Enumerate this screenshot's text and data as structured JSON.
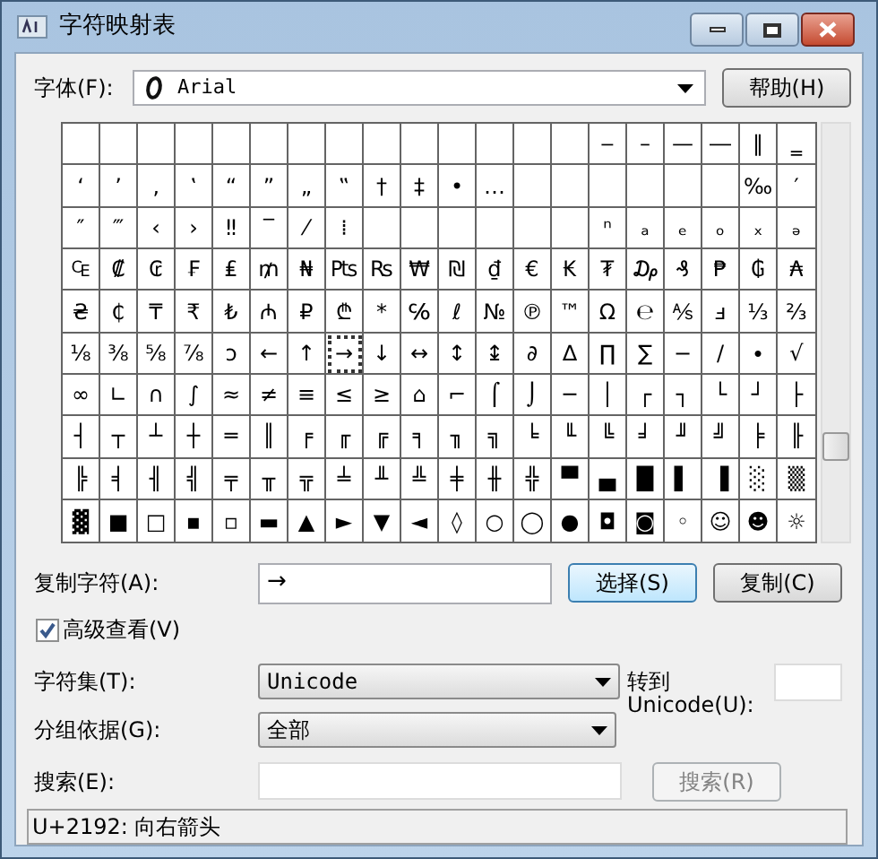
{
  "window": {
    "title": "字符映射表"
  },
  "font": {
    "label": "字体(F):",
    "value": "Arial"
  },
  "help_button": "帮助(H)",
  "grid": {
    "rows": [
      {
        "cells": [
          {
            "kind": "blank",
            "selected": false
          },
          {
            "kind": "blank",
            "selected": false
          },
          {
            "kind": "blank",
            "selected": false
          },
          {
            "kind": "blank",
            "selected": false
          },
          {
            "kind": "blank",
            "selected": false
          },
          {
            "kind": "blank",
            "selected": false
          },
          {
            "kind": "blank",
            "selected": false
          },
          {
            "kind": "blank",
            "selected": false
          },
          {
            "kind": "blank",
            "selected": false
          },
          {
            "kind": "blank",
            "selected": false
          },
          {
            "kind": "blank",
            "selected": false
          },
          {
            "kind": "blank",
            "selected": false
          },
          {
            "kind": "blank",
            "selected": false
          },
          {
            "kind": "blank",
            "selected": false
          },
          {
            "kind": "glyph",
            "char": "‒",
            "selected": false
          },
          {
            "kind": "glyph",
            "char": "–",
            "selected": false
          },
          {
            "kind": "glyph",
            "char": "—",
            "selected": false
          },
          {
            "kind": "glyph",
            "char": "―",
            "selected": false
          },
          {
            "kind": "glyph",
            "char": "‖",
            "selected": false
          },
          {
            "kind": "glyph",
            "char": "‗",
            "selected": false
          }
        ]
      },
      {
        "cells": [
          {
            "kind": "glyph",
            "char": "‘",
            "selected": false
          },
          {
            "kind": "glyph",
            "char": "’",
            "selected": false
          },
          {
            "kind": "glyph",
            "char": "‚",
            "selected": false
          },
          {
            "kind": "glyph",
            "char": "‛",
            "selected": false
          },
          {
            "kind": "glyph",
            "char": "“",
            "selected": false
          },
          {
            "kind": "glyph",
            "char": "”",
            "selected": false
          },
          {
            "kind": "glyph",
            "char": "„",
            "selected": false
          },
          {
            "kind": "glyph",
            "char": "‟",
            "selected": false
          },
          {
            "kind": "glyph",
            "char": "†",
            "selected": false
          },
          {
            "kind": "glyph",
            "char": "‡",
            "selected": false
          },
          {
            "kind": "glyph",
            "char": "•",
            "selected": false
          },
          {
            "kind": "glyph",
            "char": "…",
            "selected": false
          },
          {
            "kind": "blank",
            "selected": false
          },
          {
            "kind": "blank",
            "selected": false
          },
          {
            "kind": "blank",
            "selected": false
          },
          {
            "kind": "blank",
            "selected": false
          },
          {
            "kind": "blank",
            "selected": false
          },
          {
            "kind": "blank",
            "selected": false
          },
          {
            "kind": "glyph",
            "char": "‰",
            "selected": false
          },
          {
            "kind": "glyph",
            "char": "′",
            "selected": false
          }
        ]
      },
      {
        "cells": [
          {
            "kind": "glyph",
            "char": "″",
            "selected": false
          },
          {
            "kind": "glyph",
            "char": "‴",
            "selected": false
          },
          {
            "kind": "glyph",
            "char": "‹",
            "selected": false
          },
          {
            "kind": "glyph",
            "char": "›",
            "selected": false
          },
          {
            "kind": "glyph",
            "char": "‼",
            "selected": false
          },
          {
            "kind": "glyph",
            "char": "‾",
            "selected": false
          },
          {
            "kind": "glyph",
            "char": "⁄",
            "selected": false
          },
          {
            "kind": "glyph",
            "char": "⁞",
            "selected": false
          },
          {
            "kind": "blank",
            "selected": false
          },
          {
            "kind": "blank",
            "selected": false
          },
          {
            "kind": "blank",
            "selected": false
          },
          {
            "kind": "blank",
            "selected": false
          },
          {
            "kind": "blank",
            "selected": false
          },
          {
            "kind": "blank",
            "selected": false
          },
          {
            "kind": "glyph",
            "char": "ⁿ",
            "selected": false
          },
          {
            "kind": "glyph",
            "char": "ₐ",
            "selected": false
          },
          {
            "kind": "glyph",
            "char": "ₑ",
            "selected": false
          },
          {
            "kind": "glyph",
            "char": "ₒ",
            "selected": false
          },
          {
            "kind": "glyph",
            "char": "ₓ",
            "selected": false
          },
          {
            "kind": "glyph",
            "char": "ₔ",
            "selected": false
          }
        ]
      },
      {
        "cells": [
          {
            "kind": "glyph",
            "char": "₠",
            "selected": false
          },
          {
            "kind": "glyph",
            "char": "₡",
            "selected": false
          },
          {
            "kind": "glyph",
            "char": "₢",
            "selected": false
          },
          {
            "kind": "glyph",
            "char": "₣",
            "selected": false
          },
          {
            "kind": "glyph",
            "char": "₤",
            "selected": false
          },
          {
            "kind": "glyph",
            "char": "₥",
            "selected": false
          },
          {
            "kind": "glyph",
            "char": "₦",
            "selected": false
          },
          {
            "kind": "glyph",
            "char": "₧",
            "selected": false
          },
          {
            "kind": "glyph",
            "char": "₨",
            "selected": false
          },
          {
            "kind": "glyph",
            "char": "₩",
            "selected": false
          },
          {
            "kind": "glyph",
            "char": "₪",
            "selected": false
          },
          {
            "kind": "glyph",
            "char": "₫",
            "selected": false
          },
          {
            "kind": "glyph",
            "char": "€",
            "selected": false
          },
          {
            "kind": "glyph",
            "char": "₭",
            "selected": false
          },
          {
            "kind": "glyph",
            "char": "₮",
            "selected": false
          },
          {
            "kind": "glyph",
            "char": "₯",
            "selected": false
          },
          {
            "kind": "glyph",
            "char": "₰",
            "selected": false
          },
          {
            "kind": "glyph",
            "char": "₱",
            "selected": false
          },
          {
            "kind": "glyph",
            "char": "₲",
            "selected": false
          },
          {
            "kind": "glyph",
            "char": "₳",
            "selected": false
          }
        ]
      },
      {
        "cells": [
          {
            "kind": "glyph",
            "char": "₴",
            "selected": false
          },
          {
            "kind": "glyph",
            "char": "₵",
            "selected": false
          },
          {
            "kind": "glyph",
            "char": "₸",
            "selected": false
          },
          {
            "kind": "glyph",
            "char": "₹",
            "selected": false
          },
          {
            "kind": "glyph",
            "char": "₺",
            "selected": false
          },
          {
            "kind": "glyph",
            "char": "₼",
            "selected": false
          },
          {
            "kind": "glyph",
            "char": "₽",
            "selected": false
          },
          {
            "kind": "glyph",
            "char": "₾",
            "selected": false
          },
          {
            "kind": "glyph",
            "char": "*",
            "selected": false
          },
          {
            "kind": "glyph",
            "char": "℅",
            "selected": false
          },
          {
            "kind": "glyph",
            "char": "ℓ",
            "selected": false
          },
          {
            "kind": "glyph",
            "char": "№",
            "selected": false
          },
          {
            "kind": "glyph",
            "char": "℗",
            "selected": false
          },
          {
            "kind": "glyph",
            "char": "™",
            "selected": false
          },
          {
            "kind": "glyph",
            "char": "Ω",
            "selected": false
          },
          {
            "kind": "glyph",
            "char": "℮",
            "selected": false
          },
          {
            "kind": "glyph",
            "char": "⅍",
            "selected": false
          },
          {
            "kind": "glyph",
            "char": "ⅎ",
            "selected": false
          },
          {
            "kind": "glyph",
            "char": "⅓",
            "selected": false
          },
          {
            "kind": "glyph",
            "char": "⅔",
            "selected": false
          }
        ]
      },
      {
        "cells": [
          {
            "kind": "glyph",
            "char": "⅛",
            "selected": false
          },
          {
            "kind": "glyph",
            "char": "⅜",
            "selected": false
          },
          {
            "kind": "glyph",
            "char": "⅝",
            "selected": false
          },
          {
            "kind": "glyph",
            "char": "⅞",
            "selected": false
          },
          {
            "kind": "glyph",
            "char": "ↄ",
            "selected": false
          },
          {
            "kind": "glyph",
            "char": "←",
            "selected": false
          },
          {
            "kind": "glyph",
            "char": "↑",
            "selected": false
          },
          {
            "kind": "glyph",
            "char": "→",
            "selected": true
          },
          {
            "kind": "glyph",
            "char": "↓",
            "selected": false
          },
          {
            "kind": "glyph",
            "char": "↔",
            "selected": false
          },
          {
            "kind": "glyph",
            "char": "↕",
            "selected": false
          },
          {
            "kind": "glyph",
            "char": "↨",
            "selected": false
          },
          {
            "kind": "glyph",
            "char": "∂",
            "selected": false
          },
          {
            "kind": "glyph",
            "char": "∆",
            "selected": false
          },
          {
            "kind": "glyph",
            "char": "∏",
            "selected": false
          },
          {
            "kind": "glyph",
            "char": "∑",
            "selected": false
          },
          {
            "kind": "glyph",
            "char": "−",
            "selected": false
          },
          {
            "kind": "glyph",
            "char": "∕",
            "selected": false
          },
          {
            "kind": "glyph",
            "char": "∙",
            "selected": false
          },
          {
            "kind": "glyph",
            "char": "√",
            "selected": false
          }
        ]
      },
      {
        "cells": [
          {
            "kind": "glyph",
            "char": "∞",
            "selected": false
          },
          {
            "kind": "glyph",
            "char": "∟",
            "selected": false
          },
          {
            "kind": "glyph",
            "char": "∩",
            "selected": false
          },
          {
            "kind": "glyph",
            "char": "∫",
            "selected": false
          },
          {
            "kind": "glyph",
            "char": "≈",
            "selected": false
          },
          {
            "kind": "glyph",
            "char": "≠",
            "selected": false
          },
          {
            "kind": "glyph",
            "char": "≡",
            "selected": false
          },
          {
            "kind": "glyph",
            "char": "≤",
            "selected": false
          },
          {
            "kind": "glyph",
            "char": "≥",
            "selected": false
          },
          {
            "kind": "glyph",
            "char": "⌂",
            "selected": false
          },
          {
            "kind": "glyph",
            "char": "⌐",
            "selected": false
          },
          {
            "kind": "glyph",
            "char": "⌠",
            "selected": false
          },
          {
            "kind": "glyph",
            "char": "⌡",
            "selected": false
          },
          {
            "kind": "glyph",
            "char": "─",
            "selected": false
          },
          {
            "kind": "glyph",
            "char": "│",
            "selected": false
          },
          {
            "kind": "glyph",
            "char": "┌",
            "selected": false
          },
          {
            "kind": "glyph",
            "char": "┐",
            "selected": false
          },
          {
            "kind": "glyph",
            "char": "└",
            "selected": false
          },
          {
            "kind": "glyph",
            "char": "┘",
            "selected": false
          },
          {
            "kind": "glyph",
            "char": "├",
            "selected": false
          }
        ]
      },
      {
        "cells": [
          {
            "kind": "glyph",
            "char": "┤",
            "selected": false
          },
          {
            "kind": "glyph",
            "char": "┬",
            "selected": false
          },
          {
            "kind": "glyph",
            "char": "┴",
            "selected": false
          },
          {
            "kind": "glyph",
            "char": "┼",
            "selected": false
          },
          {
            "kind": "glyph",
            "char": "═",
            "selected": false
          },
          {
            "kind": "glyph",
            "char": "║",
            "selected": false
          },
          {
            "kind": "glyph",
            "char": "╒",
            "selected": false
          },
          {
            "kind": "glyph",
            "char": "╓",
            "selected": false
          },
          {
            "kind": "glyph",
            "char": "╔",
            "selected": false
          },
          {
            "kind": "glyph",
            "char": "╕",
            "selected": false
          },
          {
            "kind": "glyph",
            "char": "╖",
            "selected": false
          },
          {
            "kind": "glyph",
            "char": "╗",
            "selected": false
          },
          {
            "kind": "glyph",
            "char": "╘",
            "selected": false
          },
          {
            "kind": "glyph",
            "char": "╙",
            "selected": false
          },
          {
            "kind": "glyph",
            "char": "╚",
            "selected": false
          },
          {
            "kind": "glyph",
            "char": "╛",
            "selected": false
          },
          {
            "kind": "glyph",
            "char": "╜",
            "selected": false
          },
          {
            "kind": "glyph",
            "char": "╝",
            "selected": false
          },
          {
            "kind": "glyph",
            "char": "╞",
            "selected": false
          },
          {
            "kind": "glyph",
            "char": "╟",
            "selected": false
          }
        ]
      },
      {
        "cells": [
          {
            "kind": "glyph",
            "char": "╠",
            "selected": false
          },
          {
            "kind": "glyph",
            "char": "╡",
            "selected": false
          },
          {
            "kind": "glyph",
            "char": "╢",
            "selected": false
          },
          {
            "kind": "glyph",
            "char": "╣",
            "selected": false
          },
          {
            "kind": "glyph",
            "char": "╤",
            "selected": false
          },
          {
            "kind": "glyph",
            "char": "╥",
            "selected": false
          },
          {
            "kind": "glyph",
            "char": "╦",
            "selected": false
          },
          {
            "kind": "glyph",
            "char": "╧",
            "selected": false
          },
          {
            "kind": "glyph",
            "char": "╨",
            "selected": false
          },
          {
            "kind": "glyph",
            "char": "╩",
            "selected": false
          },
          {
            "kind": "glyph",
            "char": "╪",
            "selected": false
          },
          {
            "kind": "glyph",
            "char": "╫",
            "selected": false
          },
          {
            "kind": "glyph",
            "char": "╬",
            "selected": false
          },
          {
            "kind": "glyph",
            "char": "▀",
            "selected": false
          },
          {
            "kind": "glyph",
            "char": "▄",
            "selected": false
          },
          {
            "kind": "glyph",
            "char": "█",
            "selected": false
          },
          {
            "kind": "glyph",
            "char": "▌",
            "selected": false
          },
          {
            "kind": "glyph",
            "char": "▐",
            "selected": false
          },
          {
            "kind": "glyph",
            "char": "░",
            "selected": false
          },
          {
            "kind": "glyph",
            "char": "▒",
            "selected": false
          }
        ]
      },
      {
        "cells": [
          {
            "kind": "glyph",
            "char": "▓",
            "selected": false
          },
          {
            "kind": "glyph",
            "char": "■",
            "selected": false
          },
          {
            "kind": "glyph",
            "char": "□",
            "selected": false
          },
          {
            "kind": "glyph",
            "char": "▪",
            "selected": false
          },
          {
            "kind": "glyph",
            "char": "▫",
            "selected": false
          },
          {
            "kind": "glyph",
            "char": "▬",
            "selected": false
          },
          {
            "kind": "glyph",
            "char": "▲",
            "selected": false
          },
          {
            "kind": "glyph",
            "char": "►",
            "selected": false
          },
          {
            "kind": "glyph",
            "char": "▼",
            "selected": false
          },
          {
            "kind": "glyph",
            "char": "◄",
            "selected": false
          },
          {
            "kind": "glyph",
            "char": "◊",
            "selected": false
          },
          {
            "kind": "glyph",
            "char": "○",
            "selected": false
          },
          {
            "kind": "glyph",
            "char": "◯",
            "selected": false
          },
          {
            "kind": "glyph",
            "char": "●",
            "selected": false
          },
          {
            "kind": "glyph",
            "char": "◘",
            "selected": false
          },
          {
            "kind": "glyph",
            "char": "◙",
            "selected": false
          },
          {
            "kind": "glyph",
            "char": "◦",
            "selected": false
          },
          {
            "kind": "glyph",
            "char": "☺",
            "selected": false
          },
          {
            "kind": "glyph",
            "char": "☻",
            "selected": false
          },
          {
            "kind": "glyph",
            "char": "☼",
            "selected": false
          }
        ]
      }
    ]
  },
  "copy": {
    "label": "复制字符(A):",
    "value": "→"
  },
  "select_button": "选择(S)",
  "copy_button": "复制(C)",
  "advanced": {
    "label": "高级查看(V)",
    "checked": true
  },
  "charset": {
    "label": "字符集(T):",
    "value": "Unicode"
  },
  "goto": {
    "label": "转到 Unicode(U):"
  },
  "group_by": {
    "label": "分组依据(G):",
    "value": "全部"
  },
  "search": {
    "label": "搜索(E):",
    "button": "搜索(R)",
    "button_disabled": true
  },
  "status_bar": "U+2192: 向右箭头"
}
